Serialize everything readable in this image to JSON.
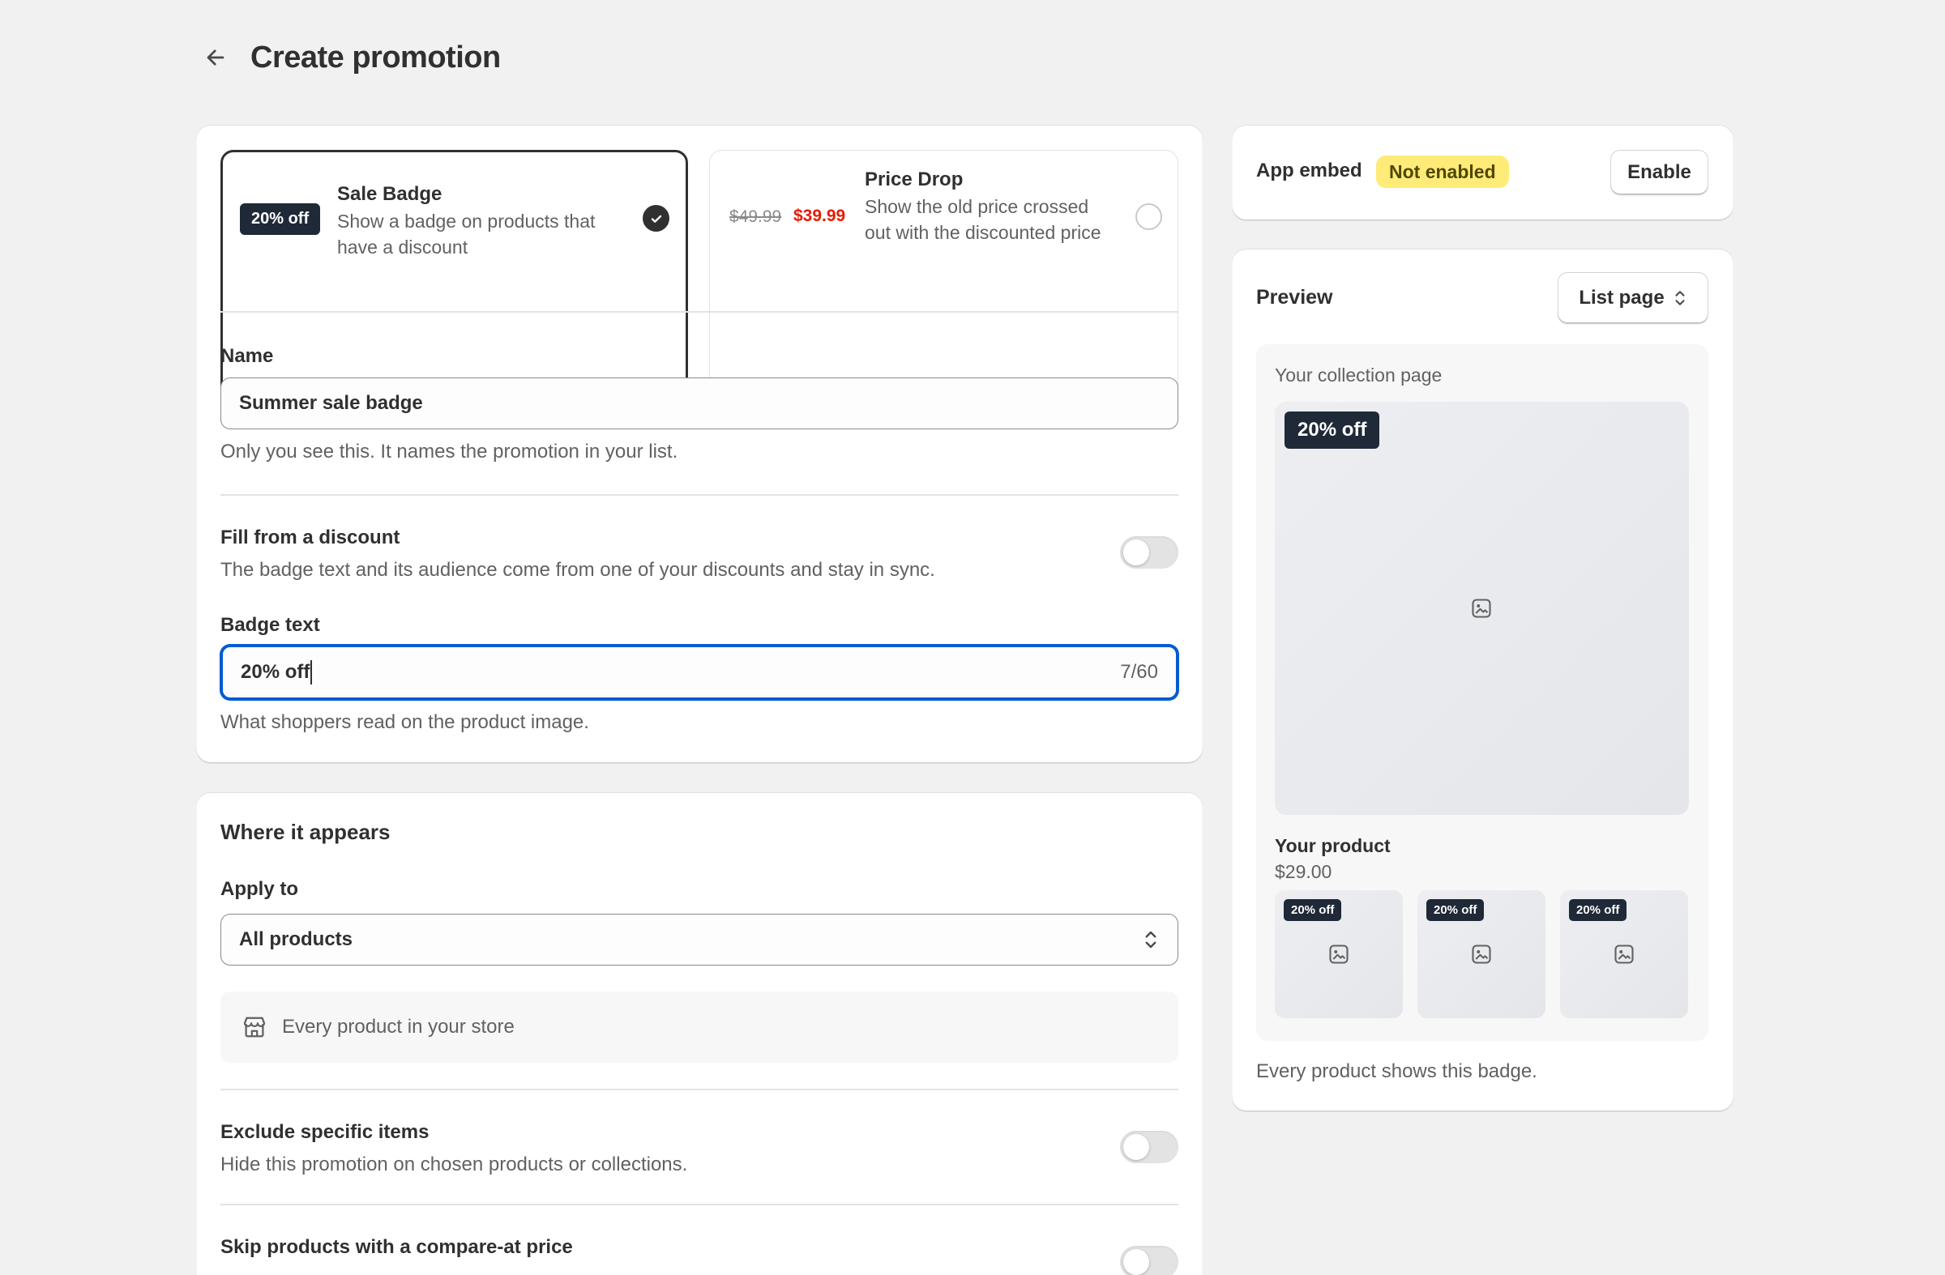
{
  "header": {
    "title": "Create promotion",
    "back_icon": "arrow-left-icon"
  },
  "promotion_types": {
    "sale_badge": {
      "badge": "20% off",
      "title": "Sale Badge",
      "description": "Show a badge on products that have a discount",
      "selected": true
    },
    "price_drop": {
      "old_price": "$49.99",
      "new_price": "$39.99",
      "title": "Price Drop",
      "description": "Show the old price crossed out with the discounted price",
      "selected": false
    }
  },
  "name_field": {
    "label": "Name",
    "value": "Summer sale badge",
    "help": "Only you see this. It names the promotion in your list."
  },
  "fill_from_discount": {
    "label": "Fill from a discount",
    "help": "The badge text and its audience come from one of your discounts and stay in sync.",
    "enabled": false
  },
  "badge_text": {
    "label": "Badge text",
    "value": "20% off",
    "count": "7/60",
    "help": "What shoppers read on the product image."
  },
  "where": {
    "title": "Where it appears",
    "apply_to_label": "Apply to",
    "apply_to_value": "All products",
    "info": "Every product in your store",
    "exclude": {
      "label": "Exclude specific items",
      "help": "Hide this promotion on chosen products or collections.",
      "enabled": false
    },
    "skip": {
      "label": "Skip products with a compare-at price",
      "enabled": false
    }
  },
  "app_embed": {
    "label": "App embed",
    "status": "Not enabled",
    "button": "Enable"
  },
  "preview": {
    "title": "Preview",
    "view_select": "List page",
    "collection_label": "Your collection page",
    "badge": "20% off",
    "product_name": "Your product",
    "product_price": "$29.00",
    "thumb_badges": [
      "20% off",
      "20% off",
      "20% off"
    ],
    "footer": "Every product shows this badge."
  },
  "colors": {
    "accent_focus": "#005bd3",
    "badge_bg": "#1f2937",
    "status_warning_bg": "#ffeb78",
    "price_red": "#e51c00"
  }
}
